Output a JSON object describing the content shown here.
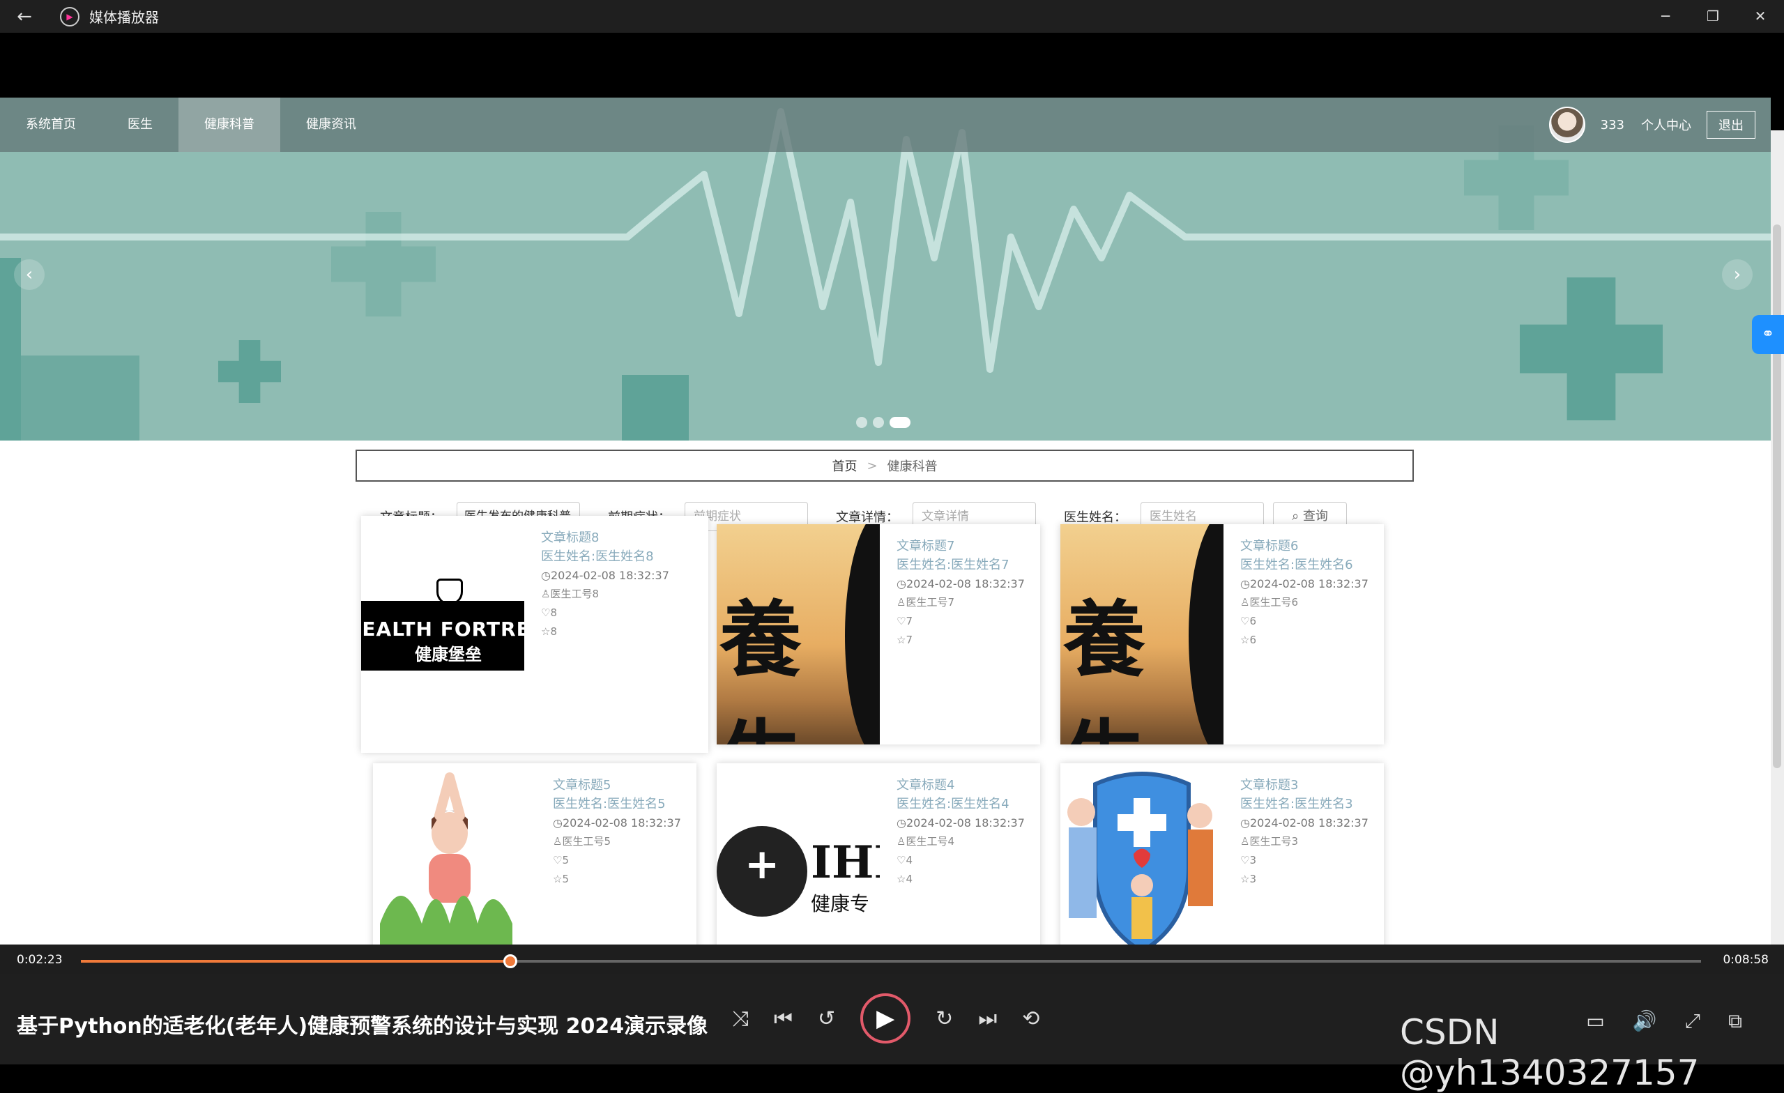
{
  "window": {
    "title": "媒体播放器",
    "controls": [
      "─",
      "❐",
      "✕"
    ]
  },
  "nav": {
    "items": [
      {
        "label": "系统首页"
      },
      {
        "label": "医生"
      },
      {
        "label": "健康科普"
      },
      {
        "label": "健康资讯"
      }
    ],
    "active_index": 2,
    "user_count": "333",
    "personal_center": "个人中心",
    "logout": "退出"
  },
  "breadcrumb": {
    "home": "首页",
    "sep": ">",
    "current": "健康科普"
  },
  "filters": {
    "title_label": "文章标题：",
    "title_value": "医生发布的健康科普",
    "symptom_label": "前期症状：",
    "symptom_placeholder": "前期症状",
    "detail_label": "文章详情：",
    "detail_placeholder": "文章详情",
    "doctor_label": "医生姓名：",
    "doctor_placeholder": "医生姓名",
    "search_label": "查询"
  },
  "cards": [
    {
      "title": "文章标题8",
      "doctor": "医生姓名:医生姓名8",
      "date": "2024-02-08 18:32:37",
      "id": "医生工号8",
      "likes": "8",
      "stars": "8",
      "img_text1": "IEALTH FORTRES",
      "img_text2": "健康堡垒"
    },
    {
      "title": "文章标题7",
      "doctor": "医生姓名:医生姓名7",
      "date": "2024-02-08 18:32:37",
      "id": "医生工号7",
      "likes": "7",
      "stars": "7",
      "img_text1": "養生"
    },
    {
      "title": "文章标题6",
      "doctor": "医生姓名:医生姓名6",
      "date": "2024-02-08 18:32:37",
      "id": "医生工号6",
      "likes": "6",
      "stars": "6",
      "img_text1": "養生"
    },
    {
      "title": "文章标题5",
      "doctor": "医生姓名:医生姓名5",
      "date": "2024-02-08 18:32:37",
      "id": "医生工号5",
      "likes": "5",
      "stars": "5"
    },
    {
      "title": "文章标题4",
      "doctor": "医生姓名:医生姓名4",
      "date": "2024-02-08 18:32:37",
      "id": "医生工号4",
      "likes": "4",
      "stars": "4",
      "img_text1": "IHI",
      "img_text2": "健康专"
    },
    {
      "title": "文章标题3",
      "doctor": "医生姓名:医生姓名3",
      "date": "2024-02-08 18:32:37",
      "id": "医生工号3",
      "likes": "3",
      "stars": "3"
    }
  ],
  "player": {
    "time_current": "0:02:23",
    "time_total": "0:08:58",
    "progress": 0.265,
    "video_title": "基于Python的适老化(老年人)健康预警系统的设计与实现 2024演示录像",
    "watermark": "CSDN @yh1340327157"
  },
  "colors": {
    "accent": "#f07a3a",
    "banner": "#8fbcb3"
  }
}
